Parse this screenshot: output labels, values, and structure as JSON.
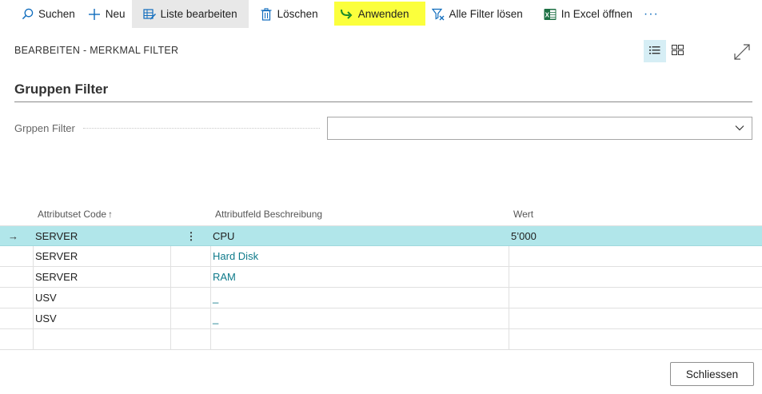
{
  "toolbar": {
    "search_label": "Suchen",
    "new_label": "Neu",
    "edit_list_label": "Liste bearbeiten",
    "delete_label": "Löschen",
    "apply_label": "Anwenden",
    "clear_filters_label": "Alle Filter lösen",
    "open_excel_label": "In Excel öffnen",
    "more_label": "···"
  },
  "header": {
    "page_title": "BEARBEITEN - MERKMAL FILTER"
  },
  "group": {
    "title": "Gruppen Filter",
    "filter_label": "Grppen Filter",
    "filter_value": ""
  },
  "grid": {
    "columns": {
      "code": "Attributset Code",
      "code_sort": "↑",
      "description": "Attributfeld Beschreibung",
      "value": "Wert"
    },
    "rows": [
      {
        "arrow": "→",
        "code": "SERVER",
        "menu": "⋮",
        "description": "CPU",
        "value": "5’000"
      },
      {
        "arrow": "",
        "code": "SERVER",
        "menu": "",
        "description": "Hard Disk",
        "value": ""
      },
      {
        "arrow": "",
        "code": "SERVER",
        "menu": "",
        "description": "RAM",
        "value": ""
      },
      {
        "arrow": "",
        "code": "USV",
        "menu": "",
        "description": "_",
        "value": ""
      },
      {
        "arrow": "",
        "code": "USV",
        "menu": "",
        "description": "_",
        "value": ""
      },
      {
        "arrow": "",
        "code": "",
        "menu": "",
        "description": "",
        "value": ""
      }
    ]
  },
  "footer": {
    "close_label": "Schliessen"
  },
  "colors": {
    "selected_row": "#b1e6ea",
    "apply_highlight": "#fbff3c",
    "link": "#0e7a8a",
    "accent": "#0f6cbd"
  }
}
